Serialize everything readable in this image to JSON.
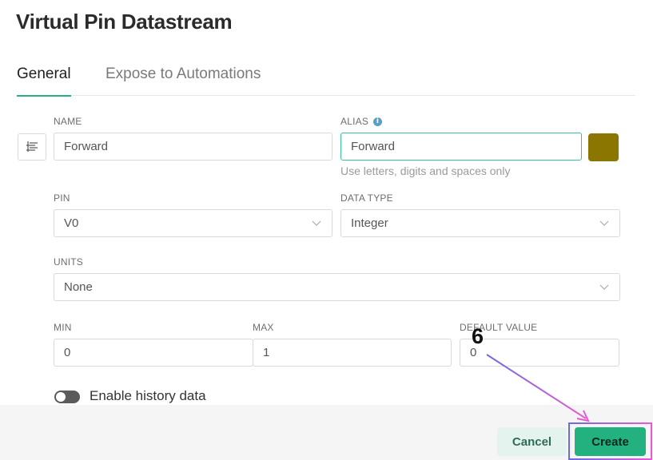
{
  "dialog": {
    "title": "Virtual Pin Datastream"
  },
  "tabs": [
    {
      "label": "General",
      "active": true
    },
    {
      "label": "Expose to Automations",
      "active": false
    }
  ],
  "fields": {
    "name": {
      "label": "NAME",
      "value": "Forward",
      "icon": "list-settings-icon"
    },
    "alias": {
      "label": "ALIAS",
      "value": "Forward",
      "info_icon": "info-icon",
      "helper": "Use letters, digits and spaces only"
    },
    "color": {
      "swatch": "#8a7600"
    },
    "pin": {
      "label": "PIN",
      "value": "V0"
    },
    "data_type": {
      "label": "DATA TYPE",
      "value": "Integer"
    },
    "units": {
      "label": "UNITS",
      "value": "None"
    },
    "min": {
      "label": "MIN",
      "value": "0"
    },
    "max": {
      "label": "MAX",
      "value": "1"
    },
    "default_value": {
      "label": "DEFAULT VALUE",
      "value": "0"
    }
  },
  "history": {
    "label": "Enable history data",
    "enabled": false
  },
  "footer": {
    "cancel_label": "Cancel",
    "create_label": "Create"
  },
  "annotation": {
    "step": "6",
    "colors": [
      "#6a6ce0",
      "#e85ad2"
    ]
  },
  "colors": {
    "accent": "#22b17f",
    "tab_underline": "#23b089",
    "focus_border": "#3bbf9a"
  }
}
